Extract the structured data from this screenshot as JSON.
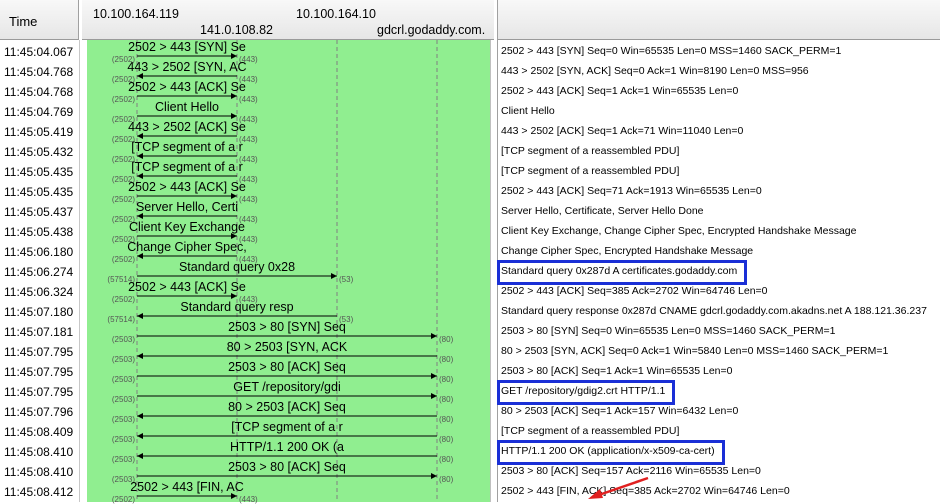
{
  "header": {
    "time_label": "Time",
    "hosts": [
      "10.100.164.119",
      "141.0.108.82",
      "10.100.164.10",
      "gdcrl.godaddy.com."
    ]
  },
  "colors": {
    "graph_bg": "#90ee90",
    "highlight": "#1a2fd6",
    "annotation_arrow": "#e02020"
  },
  "rows": [
    {
      "time": "11:45:04.067",
      "label": "2502 > 443 [SYN] Se",
      "from": 0,
      "to": 1,
      "src_port": "(2502)",
      "dst_port": "(443)",
      "comment": "2502 > 443 [SYN] Seq=0 Win=65535 Len=0 MSS=1460 SACK_PERM=1"
    },
    {
      "time": "11:45:04.768",
      "label": "443 > 2502 [SYN, AC",
      "from": 1,
      "to": 0,
      "src_port": "(2502)",
      "dst_port": "(443)",
      "comment": "443 > 2502 [SYN, ACK] Seq=0 Ack=1 Win=8190 Len=0 MSS=956"
    },
    {
      "time": "11:45:04.768",
      "label": "2502 > 443 [ACK] Se",
      "from": 0,
      "to": 1,
      "src_port": "(2502)",
      "dst_port": "(443)",
      "comment": "2502 > 443 [ACK] Seq=1 Ack=1 Win=65535 Len=0"
    },
    {
      "time": "11:45:04.769",
      "label": "Client Hello",
      "from": 0,
      "to": 1,
      "src_port": "(2502)",
      "dst_port": "(443)",
      "comment": "Client Hello"
    },
    {
      "time": "11:45:05.419",
      "label": "443 > 2502 [ACK] Se",
      "from": 1,
      "to": 0,
      "src_port": "(2502)",
      "dst_port": "(443)",
      "comment": "443 > 2502 [ACK] Seq=1 Ack=71 Win=11040 Len=0"
    },
    {
      "time": "11:45:05.432",
      "label": "[TCP segment of a r",
      "from": 1,
      "to": 0,
      "src_port": "(2502)",
      "dst_port": "(443)",
      "comment": "[TCP segment of a reassembled PDU]"
    },
    {
      "time": "11:45:05.435",
      "label": "[TCP segment of a r",
      "from": 1,
      "to": 0,
      "src_port": "(2502)",
      "dst_port": "(443)",
      "comment": "[TCP segment of a reassembled PDU]"
    },
    {
      "time": "11:45:05.435",
      "label": "2502 > 443 [ACK] Se",
      "from": 0,
      "to": 1,
      "src_port": "(2502)",
      "dst_port": "(443)",
      "comment": "2502 > 443 [ACK] Seq=71 Ack=1913 Win=65535 Len=0"
    },
    {
      "time": "11:45:05.437",
      "label": "Server Hello, Certi",
      "from": 1,
      "to": 0,
      "src_port": "(2502)",
      "dst_port": "(443)",
      "comment": "Server Hello, Certificate, Server Hello Done"
    },
    {
      "time": "11:45:05.438",
      "label": "Client Key Exchange",
      "from": 0,
      "to": 1,
      "src_port": "(2502)",
      "dst_port": "(443)",
      "comment": "Client Key Exchange, Change Cipher Spec, Encrypted Handshake Message"
    },
    {
      "time": "11:45:06.180",
      "label": "Change Cipher Spec,",
      "from": 1,
      "to": 0,
      "src_port": "(2502)",
      "dst_port": "(443)",
      "comment": "Change Cipher Spec, Encrypted Handshake Message"
    },
    {
      "time": "11:45:06.274",
      "label": "Standard query 0x28",
      "from": 0,
      "to": 2,
      "src_port": "(57514)",
      "dst_port": "(53)",
      "comment": "Standard query 0x287d  A certificates.godaddy.com",
      "highlight": true
    },
    {
      "time": "11:45:06.324",
      "label": "2502 > 443 [ACK] Se",
      "from": 0,
      "to": 1,
      "src_port": "(2502)",
      "dst_port": "(443)",
      "comment": "2502 > 443 [ACK] Seq=385 Ack=2702 Win=64746 Len=0"
    },
    {
      "time": "11:45:07.180",
      "label": "Standard query resp",
      "from": 2,
      "to": 0,
      "src_port": "(57514)",
      "dst_port": "(53)",
      "comment": "Standard query response 0x287d  CNAME gdcrl.godaddy.com.akadns.net A 188.121.36.237"
    },
    {
      "time": "11:45:07.181",
      "label": "2503 > 80 [SYN] Seq",
      "from": 0,
      "to": 3,
      "src_port": "(2503)",
      "dst_port": "(80)",
      "comment": "2503 > 80 [SYN] Seq=0 Win=65535 Len=0 MSS=1460 SACK_PERM=1"
    },
    {
      "time": "11:45:07.795",
      "label": "80 > 2503 [SYN, ACK",
      "from": 3,
      "to": 0,
      "src_port": "(2503)",
      "dst_port": "(80)",
      "comment": "80 > 2503 [SYN, ACK] Seq=0 Ack=1 Win=5840 Len=0 MSS=1460 SACK_PERM=1"
    },
    {
      "time": "11:45:07.795",
      "label": "2503 > 80 [ACK] Seq",
      "from": 0,
      "to": 3,
      "src_port": "(2503)",
      "dst_port": "(80)",
      "comment": "2503 > 80 [ACK] Seq=1 Ack=1 Win=65535 Len=0"
    },
    {
      "time": "11:45:07.795",
      "label": "GET /repository/gdi",
      "from": 0,
      "to": 3,
      "src_port": "(2503)",
      "dst_port": "(80)",
      "comment": "GET /repository/gdig2.crt HTTP/1.1",
      "highlight": true
    },
    {
      "time": "11:45:07.796",
      "label": "80 > 2503 [ACK] Seq",
      "from": 3,
      "to": 0,
      "src_port": "(2503)",
      "dst_port": "(80)",
      "comment": "80 > 2503 [ACK] Seq=1 Ack=157 Win=6432 Len=0"
    },
    {
      "time": "11:45:08.409",
      "label": "[TCP segment of a r",
      "from": 3,
      "to": 0,
      "src_port": "(2503)",
      "dst_port": "(80)",
      "comment": "[TCP segment of a reassembled PDU]"
    },
    {
      "time": "11:45:08.410",
      "label": "HTTP/1.1 200 OK  (a",
      "from": 3,
      "to": 0,
      "src_port": "(2503)",
      "dst_port": "(80)",
      "comment": "HTTP/1.1 200 OK  (application/x-x509-ca-cert)",
      "highlight": true
    },
    {
      "time": "11:45:08.410",
      "label": "2503 > 80 [ACK] Seq",
      "from": 0,
      "to": 3,
      "src_port": "(2503)",
      "dst_port": "(80)",
      "comment": "2503 > 80 [ACK] Seq=157 Ack=2116 Win=65535 Len=0"
    },
    {
      "time": "11:45:08.412",
      "label": "2502 > 443 [FIN, AC",
      "from": 0,
      "to": 1,
      "src_port": "(2502)",
      "dst_port": "(443)",
      "comment": "2502 > 443 [FIN, ACK] Seq=385 Ack=2702 Win=64746 Len=0"
    }
  ]
}
